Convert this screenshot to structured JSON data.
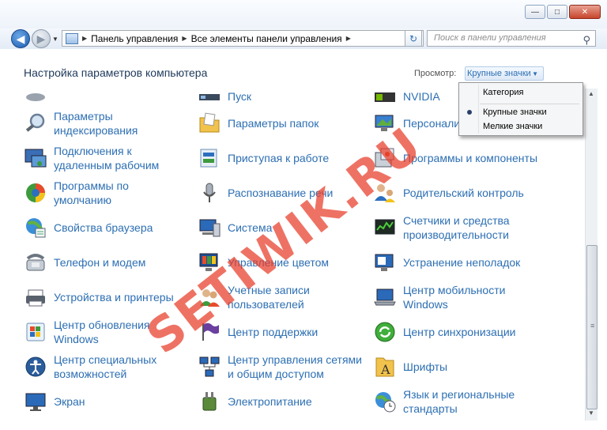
{
  "window": {
    "minimize_glyph": "—",
    "maximize_glyph": "□",
    "close_glyph": "✕"
  },
  "navigation": {
    "back_glyph": "◀",
    "forward_glyph": "▶",
    "breadcrumbs": [
      "Панель управления",
      "Все элементы панели управления"
    ],
    "search_placeholder": "Поиск в панели управления"
  },
  "header": {
    "title": "Настройка параметров компьютера",
    "view_label": "Просмотр:",
    "view_selected": "Крупные значки"
  },
  "view_menu": {
    "options": [
      "Категория",
      "Крупные значки",
      "Мелкие значки"
    ],
    "selected": "Крупные значки"
  },
  "items": {
    "col0": [
      "",
      "Параметры индексирования",
      "Подключения к удаленным рабочим",
      "Программы по умолчанию",
      "Свойства браузера",
      "Телефон и модем",
      "Устройства и принтеры",
      "Центр обновления Windows",
      "Центр специальных возможностей",
      "Экран"
    ],
    "col1": [
      "Пуск",
      "Параметры папок",
      "Приступая к работе",
      "Распознавание речи",
      "Система",
      "Управление цветом",
      "Учетные записи пользователей",
      "Центр поддержки",
      "Центр управления сетями и общим доступом",
      "Электропитание"
    ],
    "col2": [
      "NVIDIA",
      "Персонали",
      "Программы и компоненты",
      "Родительский контроль",
      "Счетчики и средства производительности",
      "Устранение неполадок",
      "Центр мобильности Windows",
      "Центр синхронизации",
      "Шрифты",
      "Язык и региональные стандарты"
    ]
  },
  "watermark": "SETIWIK.RU",
  "colors": {
    "link": "#2d6fb3",
    "title": "#1e395b",
    "watermark": "#e83c28"
  }
}
